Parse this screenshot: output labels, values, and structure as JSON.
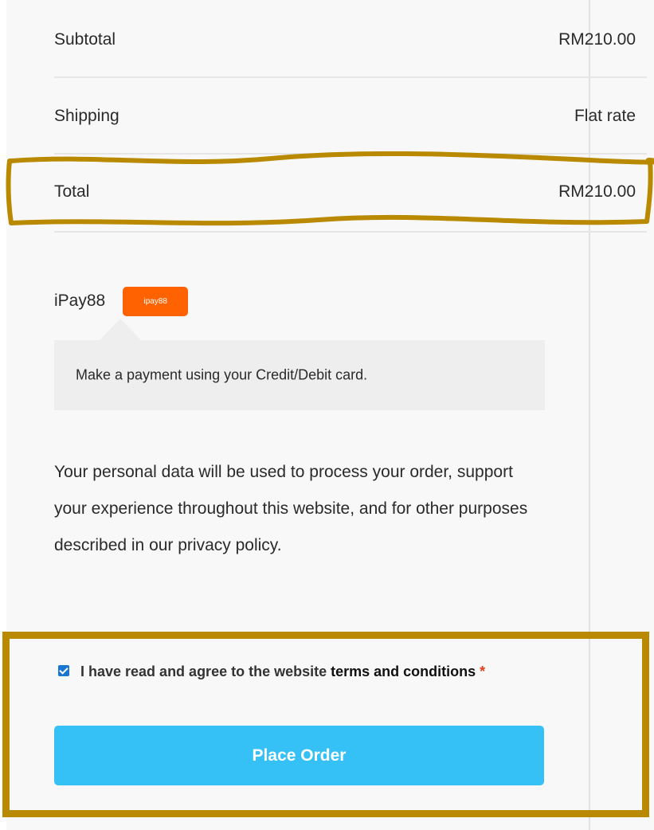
{
  "totals": {
    "subtotal_label": "Subtotal",
    "subtotal_value": "RM210.00",
    "shipping_label": "Shipping",
    "shipping_value": "Flat rate",
    "total_label": "Total",
    "total_value": "RM210.00"
  },
  "payment": {
    "method_name": "iPay88",
    "logo_text": "ipay88",
    "description": "Make a payment using your Credit/Debit card."
  },
  "privacy_text": "Your personal data will be used to process your order, support your experience throughout this website, and for other purposes described in our privacy policy.",
  "terms": {
    "checked": true,
    "text": "I have read and agree to the website",
    "link_text": "terms and conditions",
    "required_mark": "*"
  },
  "place_order_label": "Place Order",
  "colors": {
    "highlight": "#b98a00",
    "button": "#35c0f6",
    "ipay_logo": "#ff6200",
    "checkbox": "#1976d2"
  }
}
